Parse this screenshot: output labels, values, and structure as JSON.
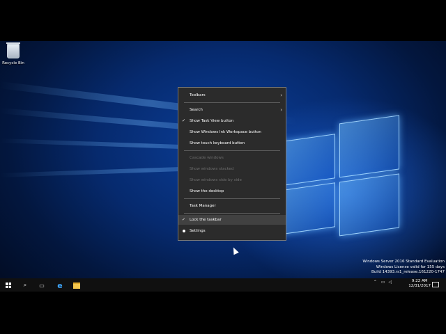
{
  "desktop": {
    "icons": [
      {
        "label": "Recycle Bin",
        "icon": "recycle-bin-icon"
      }
    ],
    "watermark": {
      "line1": "Windows Server 2016 Standard Evaluation",
      "line2": "Windows License valid for 155 days",
      "line3": "Build 14393.rs1_release.161220-1747"
    }
  },
  "context_menu": {
    "items": [
      {
        "label": "Toolbars",
        "submenu": true,
        "checked": false,
        "enabled": true
      },
      {
        "label": "Search",
        "submenu": true,
        "checked": false,
        "enabled": true
      },
      {
        "label": "Show Task View button",
        "checked": true,
        "enabled": true
      },
      {
        "label": "Show Windows Ink Workspace button",
        "checked": false,
        "enabled": true
      },
      {
        "label": "Show touch keyboard button",
        "checked": false,
        "enabled": true
      },
      {
        "label": "Cascade windows",
        "checked": false,
        "enabled": false
      },
      {
        "label": "Show windows stacked",
        "checked": false,
        "enabled": false
      },
      {
        "label": "Show windows side by side",
        "checked": false,
        "enabled": false
      },
      {
        "label": "Show the desktop",
        "checked": false,
        "enabled": true
      },
      {
        "label": "Task Manager",
        "checked": false,
        "enabled": true
      },
      {
        "label": "Lock the taskbar",
        "checked": true,
        "enabled": true
      },
      {
        "label": "Settings",
        "checked": false,
        "enabled": true,
        "icon": "gear-icon"
      }
    ],
    "hovered": "Lock the taskbar"
  },
  "taskbar": {
    "apps": [
      "start-icon",
      "search-icon",
      "task-view-icon",
      "internet-explorer-icon",
      "file-explorer-icon"
    ],
    "tray_icons": [
      "chevron-up-icon",
      "network-icon",
      "volume-icon"
    ],
    "clock_time": "9:22 AM",
    "clock_date": "12/31/2017"
  }
}
